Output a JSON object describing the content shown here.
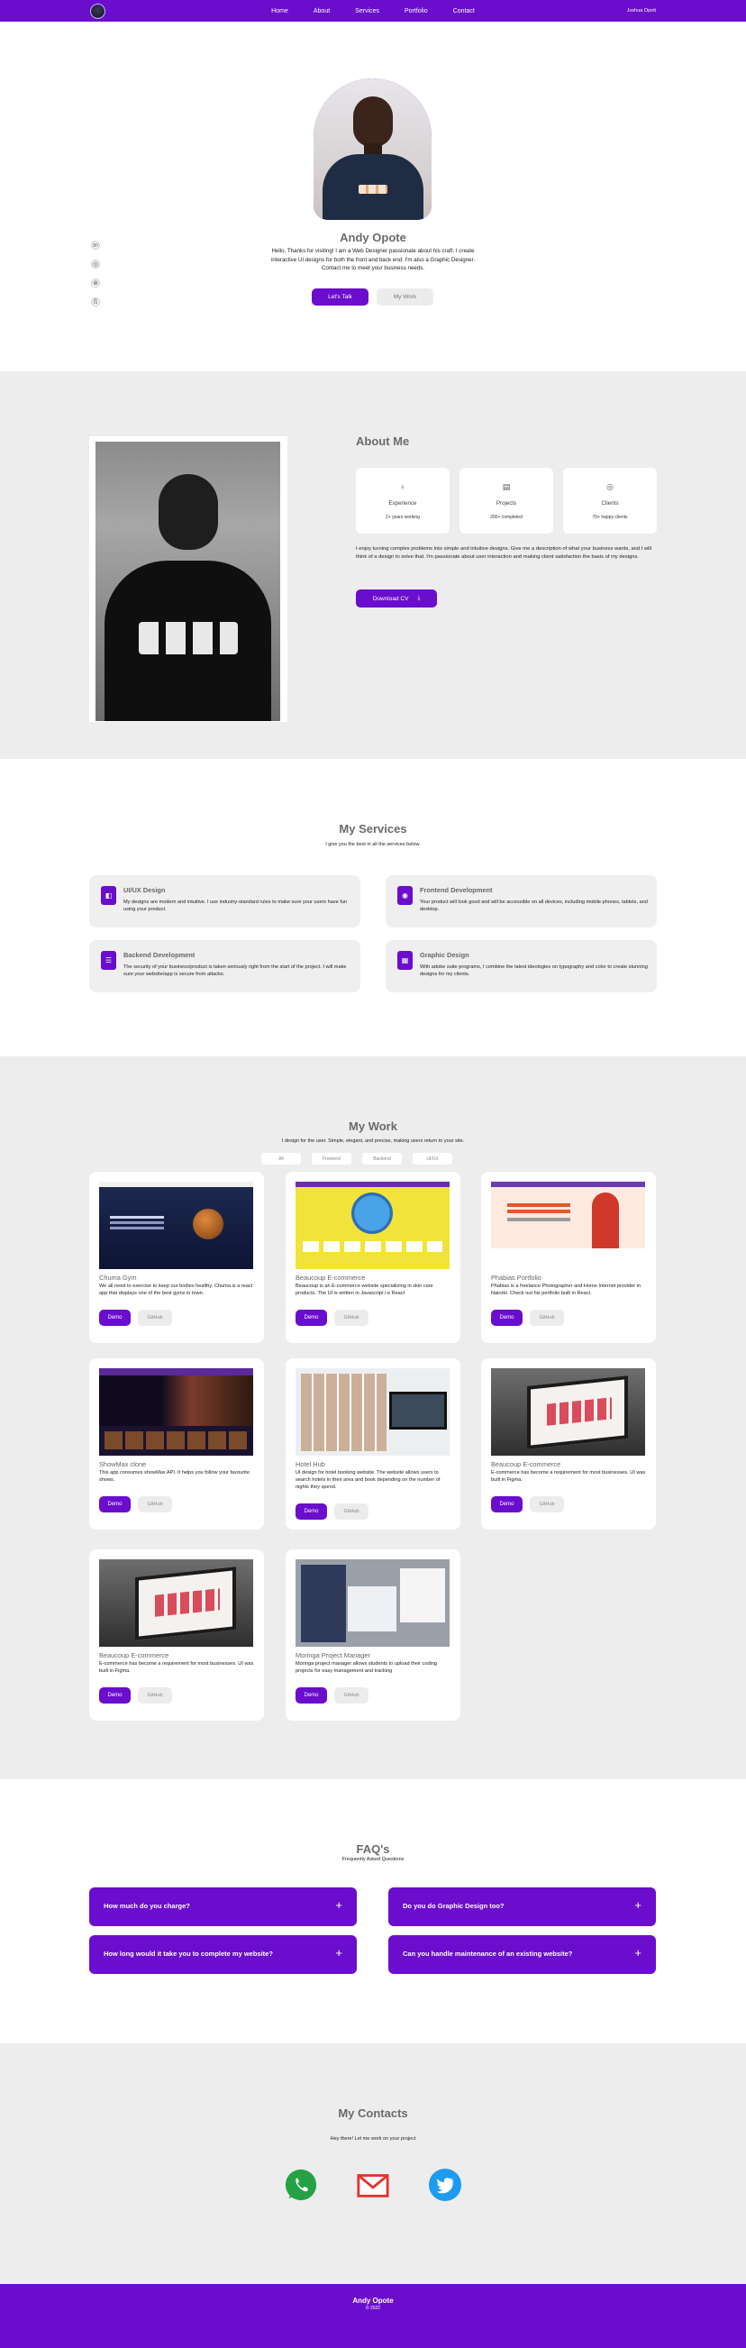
{
  "nav": {
    "links": [
      "Home",
      "About",
      "Services",
      "Portfolio",
      "Contact"
    ],
    "right": "Joshua Opoti",
    "logo_icon": "avatar-logo"
  },
  "hero": {
    "name": "Andy Opote",
    "bio": "Hello. Thanks for visiting! I am a Web Designer passionate about his craft. I create interactive UI designs for both the front and back end. I'm also a Graphic Designer. Contact me to meet your business needs.",
    "talk_label": "Let's Talk",
    "work_label": "My Work",
    "social_icons": [
      "linkedin-icon",
      "github-icon",
      "dribbble-icon",
      "behance-icon"
    ]
  },
  "about": {
    "title": "About Me",
    "cards": [
      {
        "icon": "award-icon",
        "title": "Experience",
        "sub": "2+ years working"
      },
      {
        "icon": "folder-icon",
        "title": "Projects",
        "sub": "200+ completed"
      },
      {
        "icon": "users-icon",
        "title": "Clients",
        "sub": "70+ happy clients"
      }
    ],
    "paragraph": "I enjoy turning complex problems into simple and intuitive designs. Give me a description of what your business wants, and I will think of a design to solve that. I'm passionate about user interaction and making client satisfaction the basis of my designs.",
    "cv_label": "Download CV"
  },
  "services": {
    "title": "My Services",
    "subtitle": "I give you the best in all the services below.",
    "items": [
      {
        "title": "UI/UX Design",
        "desc": "My designs are modern and intuitive. I use industry-standard rules to make sure your users have fun using your product."
      },
      {
        "title": "Frontend Development",
        "desc": "Your product will look good and will be accessible on all devices, including mobile phones, tablets, and desktop."
      },
      {
        "title": "Backend Development",
        "desc": "The security of your business/product is taken seriously right from the start of the project. I will make sure your website/app is secure from attacks."
      },
      {
        "title": "Graphic Design",
        "desc": "With adobe suite programs, I combine the latest ideologies on typography and color to create stunning designs for my clients."
      }
    ]
  },
  "work": {
    "title": "My Work",
    "subtitle": "I design for the user. Simple, elegant, and precise, making users return to your site.",
    "filters": [
      "All",
      "Frontend",
      "Backend",
      "UI/UX"
    ],
    "demo_label": "Demo",
    "github_label": "GitHub",
    "projects": [
      {
        "title": "Chuma Gym",
        "desc": "We all need to exercise to keep our bodies healthy. Chuma is a react app that displays one of the best gyms in town."
      },
      {
        "title": "Beaucoup E-commerce",
        "desc": "Beaucoup is an E-commerce website specializing in skin care products. The UI is written in Javascript i.e React"
      },
      {
        "title": "Phabias Portfolio",
        "desc": "Phabias is a freelance Photographer and Home Internet provider in Nairobi. Check out his portfolio built in React."
      },
      {
        "title": "ShowMax clone",
        "desc": "This app consumes showMax API. It helps you follow your favourite shows."
      },
      {
        "title": "Hotel Hub",
        "desc": "UI design for hotel booking website. The website allows users to search hotels in their area and book depending on the number of nights they spend."
      },
      {
        "title": "Beaucoup E-commerce",
        "desc": "E-commerce has become a requirement for most businesses. UI was built in Figma."
      },
      {
        "title": "Beaucoup E-commerce",
        "desc": "E-commerce has become a requirement for most businesses. UI was built in Figma."
      },
      {
        "title": "Moringa Project Manager",
        "desc": "Moringa project manager allows students to upload their coding projects for easy management and tracking"
      }
    ]
  },
  "faq": {
    "title": "FAQ's",
    "subtitle": "Frequently Asked Questions",
    "items": [
      "How much do you charge?",
      "Do you do Graphic Design too?",
      "How long would it take you to complete my website?",
      "Can you handle maintenance of an existing website?"
    ]
  },
  "contacts": {
    "title": "My Contacts",
    "subtitle": "Hey there! Let me work on your project",
    "icons": [
      "whatsapp-icon",
      "gmail-icon",
      "twitter-icon"
    ],
    "colors": {
      "whatsapp": "#25a244",
      "gmail": "#e3342f",
      "twitter": "#1d9bf0"
    }
  },
  "footer": {
    "name": "Andy Opote",
    "copy": "© 2022"
  },
  "theme": {
    "accent": "#6a0dcc",
    "section_gray": "#ededed"
  }
}
